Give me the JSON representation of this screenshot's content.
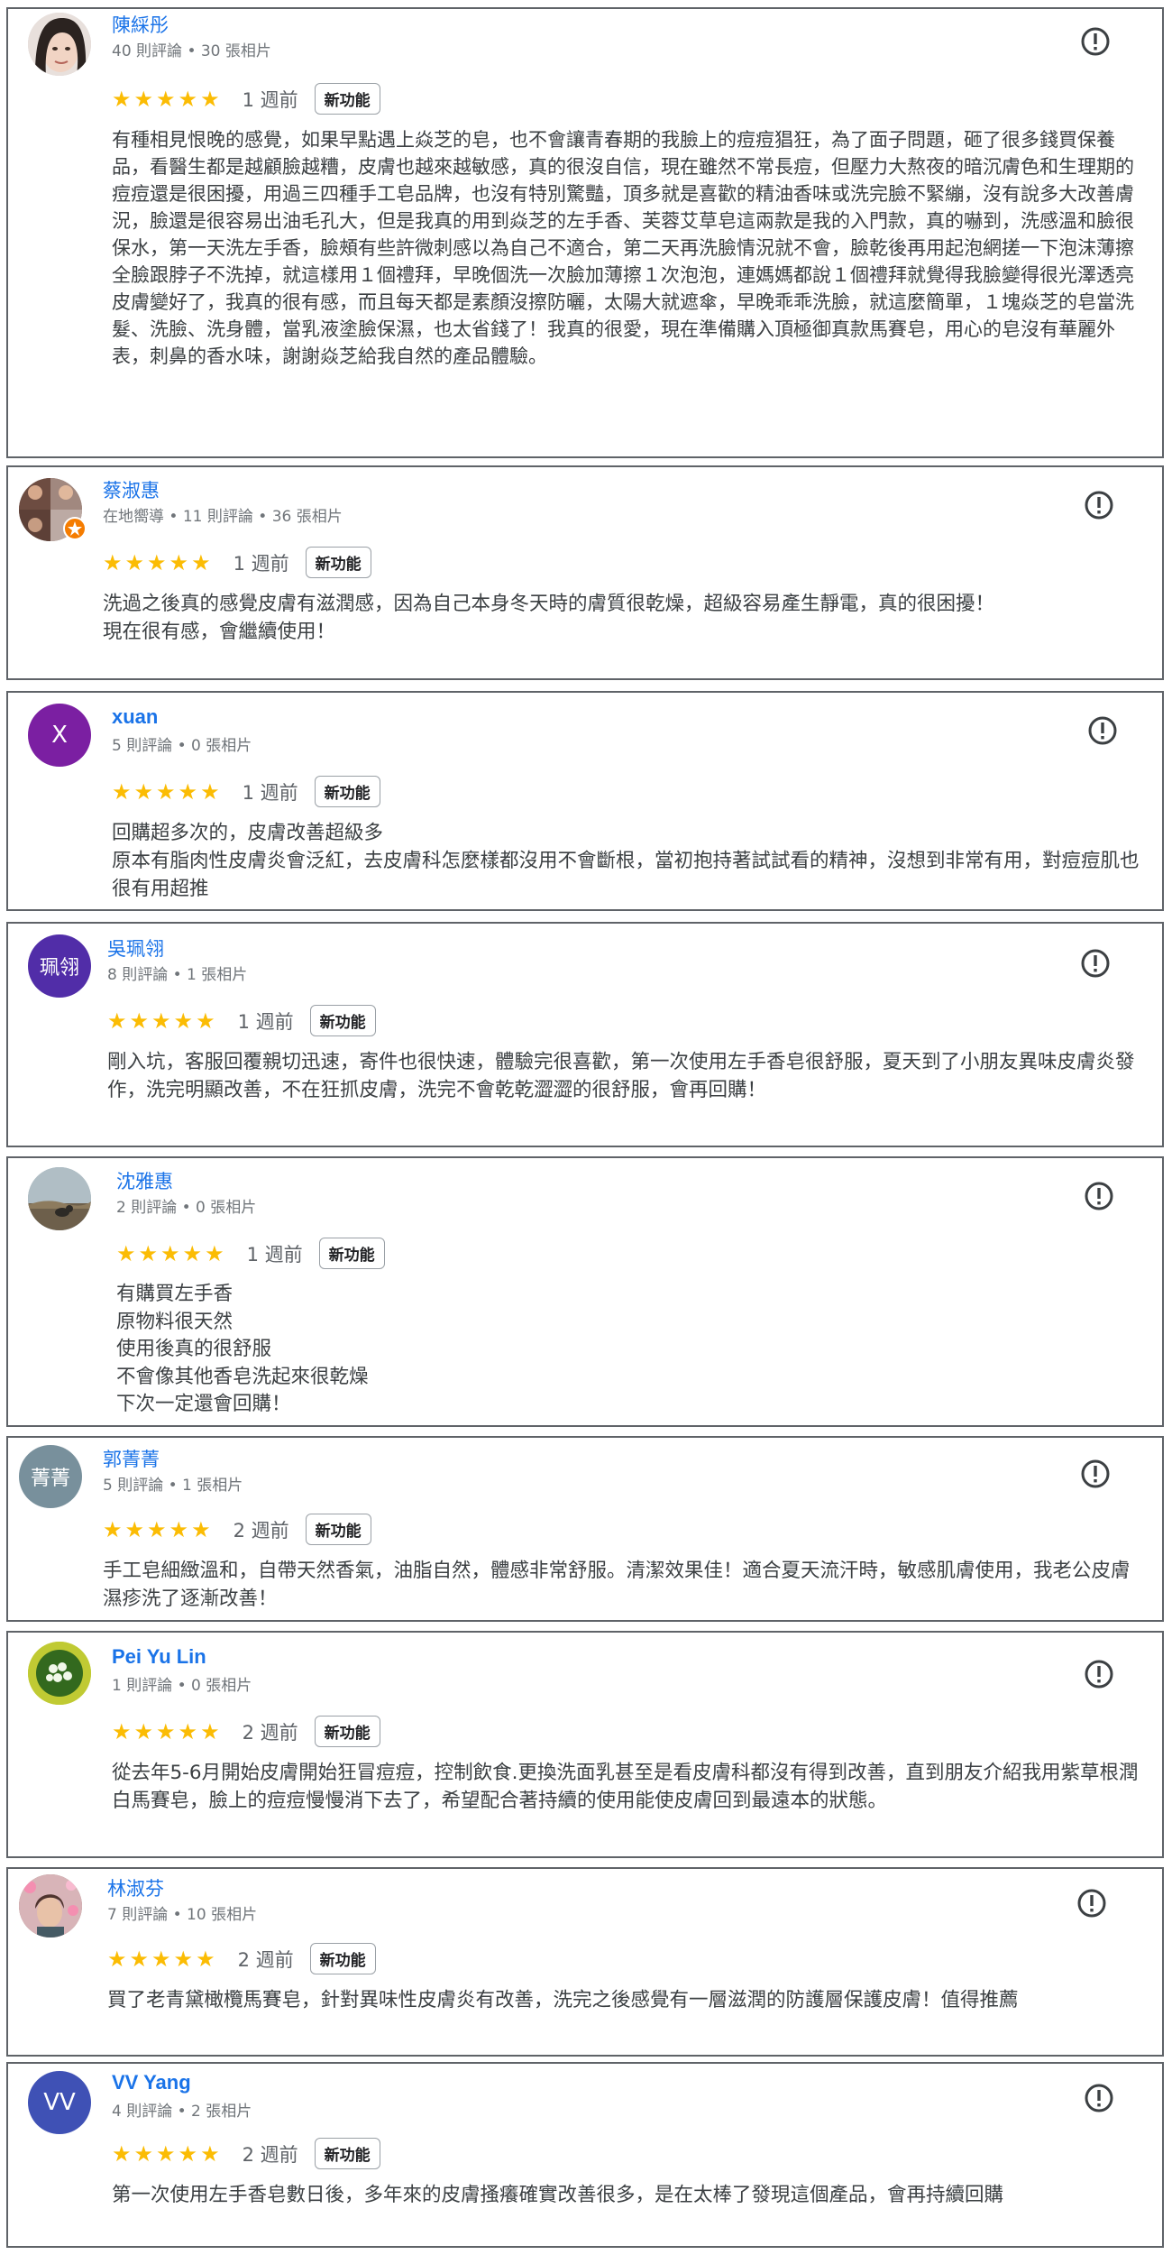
{
  "new_feature_label": "新功能",
  "star_color": "#fbbc04",
  "name_color": "#1a73e8",
  "reviews": [
    {
      "name": "陳綵彤",
      "meta": "40 則評論 • 30 張相片",
      "stars": "★★★★★",
      "rating": 5,
      "when": "1 週前",
      "avatar_icon": "woman-photo-avatar",
      "text": "有種相見恨晚的感覺，如果早點遇上焱芝的皂，也不會讓青春期的我臉上的痘痘猖狂，為了面子問題，砸了很多錢買保養品，看醫生都是越顧臉越糟，皮膚也越來越敏感，真的很沒自信，現在雖然不常長痘，但壓力大熬夜的暗沉膚色和生理期的痘痘還是很困擾，用過三四種手工皂品牌，也沒有特別驚豔，頂多就是喜歡的精油香味或洗完臉不緊繃，沒有說多大改善膚況，臉還是很容易出油毛孔大，但是我真的用到焱芝的左手香、芙蓉艾草皂這兩款是我的入門款，真的嚇到，洗感溫和臉很保水，第一天洗左手香，臉頰有些許微刺感以為自己不適合，第二天再洗臉情況就不會，臉乾後再用起泡網搓一下泡沫薄擦全臉跟脖子不洗掉，就這樣用１個禮拜，早晚個洗一次臉加薄擦１次泡泡，連媽媽都說１個禮拜就覺得我臉變得很光澤透亮皮膚變好了，我真的很有感，而且每天都是素顏沒擦防曬，太陽大就遮傘，早晚乖乖洗臉，就這麼簡單，１塊焱芝的皂當洗髮、洗臉、洗身體，當乳液塗臉保濕，也太省錢了！我真的很愛，現在準備購入頂極御真款馬賽皂，用心的皂沒有華麗外表，刺鼻的香水味，謝謝焱芝給我自然的產品體驗。"
    },
    {
      "name": "蔡淑惠",
      "meta": "在地嚮導 • 11 則評論 • 36 張相片",
      "stars": "★★★★★",
      "rating": 5,
      "when": "1 週前",
      "avatar_icon": "collage-photo-avatar",
      "badge_icon": "local-guide-badge-icon",
      "text": "洗過之後真的感覺皮膚有滋潤感，因為自己本身冬天時的膚質很乾燥，超級容易產生靜電，真的很困擾！\n現在很有感，會繼續使用！"
    },
    {
      "name": "xuan",
      "meta": "5 則評論 • 0 張相片",
      "stars": "★★★★★",
      "rating": 5,
      "when": "1 週前",
      "avatar_letter": "X",
      "avatar_color": "#7b1fa2",
      "text": "回購超多次的，皮膚改善超級多\n原本有脂肉性皮膚炎會泛紅，去皮膚科怎麼樣都沒用不會斷根，當初抱持著試試看的精神，沒想到非常有用，對痘痘肌也很有用超推"
    },
    {
      "name": "吳珮翎",
      "meta": "8 則評論 • 1 張相片",
      "stars": "★★★★★",
      "rating": 5,
      "when": "1 週前",
      "avatar_letter": "珮翎",
      "avatar_color": "#512da8",
      "text": "剛入坑，客服回覆親切迅速，寄件也很快速，體驗完很喜歡，第一次使用左手香皂很舒服，夏天到了小朋友異味皮膚炎發作，洗完明顯改善，不在狂抓皮膚，洗完不會乾乾澀澀的很舒服，會再回購！"
    },
    {
      "name": "沈雅惠",
      "meta": "2 則評論 • 0 張相片",
      "stars": "★★★★★",
      "rating": 5,
      "when": "1 週前",
      "avatar_icon": "landscape-photo-avatar",
      "text": "有購買左手香\n原物料很天然\n使用後真的很舒服\n不會像其他香皂洗起來很乾燥\n下次一定還會回購！"
    },
    {
      "name": "郭菁菁",
      "meta": "5 則評論 • 1 張相片",
      "stars": "★★★★★",
      "rating": 5,
      "when": "2 週前",
      "avatar_letter": "菁菁",
      "avatar_color": "#78909c",
      "text": "手工皂細緻溫和，自帶天然香氣，油脂自然，體感非常舒服。清潔效果佳！適合夏天流汗時，敏感肌膚使用，我老公皮膚濕疹洗了逐漸改善！"
    },
    {
      "name": "Pei Yu Lin",
      "meta": "1 則評論 • 0 張相片",
      "stars": "★★★★★",
      "rating": 5,
      "when": "2 週前",
      "avatar_icon": "flower-photo-avatar",
      "text": "從去年5-6月開始皮膚開始狂冒痘痘，控制飲食.更換洗面乳甚至是看皮膚科都沒有得到改善，直到朋友介紹我用紫草根潤白馬賽皂，臉上的痘痘慢慢消下去了，希望配合著持續的使用能使皮膚回到最遠本的狀態。"
    },
    {
      "name": "林淑芬",
      "meta": "7 則評論 • 10 張相片",
      "stars": "★★★★★",
      "rating": 5,
      "when": "2 週前",
      "avatar_icon": "blossom-photo-avatar",
      "text": "買了老青黛橄欖馬賽皂，針對異味性皮膚炎有改善，洗完之後感覺有一層滋潤的防護層保護皮膚！值得推薦"
    },
    {
      "name": "VV Yang",
      "meta": "4 則評論 • 2 張相片",
      "stars": "★★★★★",
      "rating": 5,
      "when": "2 週前",
      "avatar_letter": "VV",
      "avatar_color": "#3f51b5",
      "text": "第一次使用左手香皂數日後，多年來的皮膚搔癢確實改善很多，是在太棒了發現這個產品，會再持續回購"
    }
  ]
}
